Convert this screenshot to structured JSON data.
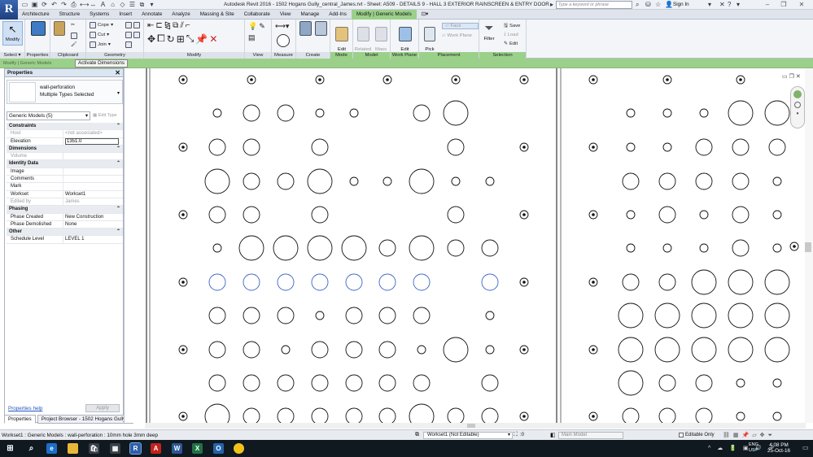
{
  "window": {
    "title": "Autodesk Revit 2016 -    1502 Hogans Gully_central_James.rvt - Sheet: A509 - DETAILS 9 - HALL 3 EXTERIOR RAINSCREEN & ENTRY DOOR",
    "search_placeholder": "Type a keyword or phrase",
    "signin": "Sign In"
  },
  "app_button": "R",
  "tabs": [
    "Architecture",
    "Structure",
    "Systems",
    "Insert",
    "Annotate",
    "Analyze",
    "Massing & Site",
    "Collaborate",
    "View",
    "Manage",
    "Add-Ins",
    "Modify | Generic Models"
  ],
  "ribbon": {
    "select": {
      "modify": "Modify",
      "label": "Select ▾"
    },
    "properties": {
      "label": "Properties"
    },
    "clipboard": {
      "label": "Clipboard"
    },
    "geometry": {
      "label": "Geometry",
      "cope": "Cope",
      "cut": "Cut",
      "join": "Join"
    },
    "modify": {
      "label": "Modify"
    },
    "view": {
      "label": "View"
    },
    "measure": {
      "label": "Measure"
    },
    "create": {
      "label": "Create"
    },
    "mode": {
      "edit_family": "Edit\nFamily",
      "label": "Mode"
    },
    "model": {
      "related_hosts": "Related\nHosts",
      "mass_floors": "Mass\nFloors",
      "label": "Model"
    },
    "workplane": {
      "edit_work_plane": "Edit\nWork Plane",
      "label": "Work Plane"
    },
    "placement": {
      "pick_new": "Pick\nNew",
      "face": "Face",
      "work_plane": "Work Plane",
      "label": "Placement"
    },
    "selection": {
      "filter": "Filter",
      "save": "Save",
      "load": "Load",
      "edit": "Edit",
      "label": "Selection"
    }
  },
  "options_bar": {
    "context": "Modify | Generic Models",
    "activate_dimensions": "Activate Dimensions"
  },
  "properties": {
    "title": "Properties",
    "type_name": "wall-perforation",
    "type_sub": "Multiple Types Selected",
    "filter": "Generic Models (5)",
    "edit_type": "Edit Type",
    "rows": [
      {
        "cat": "Constraints"
      },
      {
        "k": "Host",
        "v": "<not associated>",
        "grey": true
      },
      {
        "k": "Elevation",
        "v": "1351.0",
        "input": true
      },
      {
        "cat": "Dimensions"
      },
      {
        "k": "Volume",
        "v": "",
        "grey": true
      },
      {
        "cat": "Identity Data"
      },
      {
        "k": "Image",
        "v": ""
      },
      {
        "k": "Comments",
        "v": ""
      },
      {
        "k": "Mark",
        "v": ""
      },
      {
        "k": "Workset",
        "v": "Workset1"
      },
      {
        "k": "Edited by",
        "v": "James",
        "grey": true
      },
      {
        "cat": "Phasing"
      },
      {
        "k": "Phase Created",
        "v": "New Construction"
      },
      {
        "k": "Phase Demolished",
        "v": "None"
      },
      {
        "cat": "Other"
      },
      {
        "k": "Schedule Level",
        "v": "LEVEL 1"
      }
    ],
    "help": "Properties help",
    "apply": "Apply",
    "tab_properties": "Properties",
    "tab_browser": "Project Browser - 1502 Hogans Gully..."
  },
  "status": {
    "text": "Workset1 : Generic Models : wall-perforation : 10mm hole 3mm deep",
    "workset": "Workset1 (Not Editable)",
    "zero": ":0",
    "main_model": "Main Model",
    "editable_only": "Editable Only"
  },
  "taskbar": {
    "lang": "ENG\nUS",
    "time": "4:08 PM",
    "date": "25-Oct-16"
  },
  "colors": {
    "ribbon_accent": "#9bd08a",
    "selected_element": "#3b64c8",
    "drawing_line": "#111111"
  }
}
